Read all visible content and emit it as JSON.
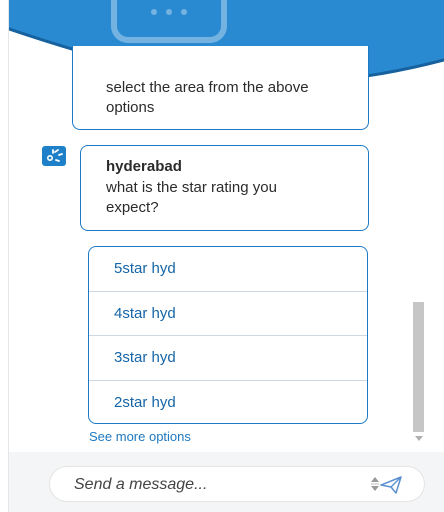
{
  "conversation": {
    "prev_message": "select the area from the above options",
    "bot_title": "hyderabad",
    "bot_question": "what is the star rating you expect?",
    "options": [
      {
        "label": "5star hyd"
      },
      {
        "label": "4star hyd"
      },
      {
        "label": "3star hyd"
      },
      {
        "label": "2star hyd"
      }
    ],
    "see_more": "See more options"
  },
  "composer": {
    "placeholder": "Send a message..."
  },
  "colors": {
    "brand_blue": "#1d80c8",
    "option_text": "#1565a8"
  },
  "icons": {
    "header": "chat-bubble-icon",
    "avatar": "bot-avatar-icon",
    "send": "send-icon"
  }
}
